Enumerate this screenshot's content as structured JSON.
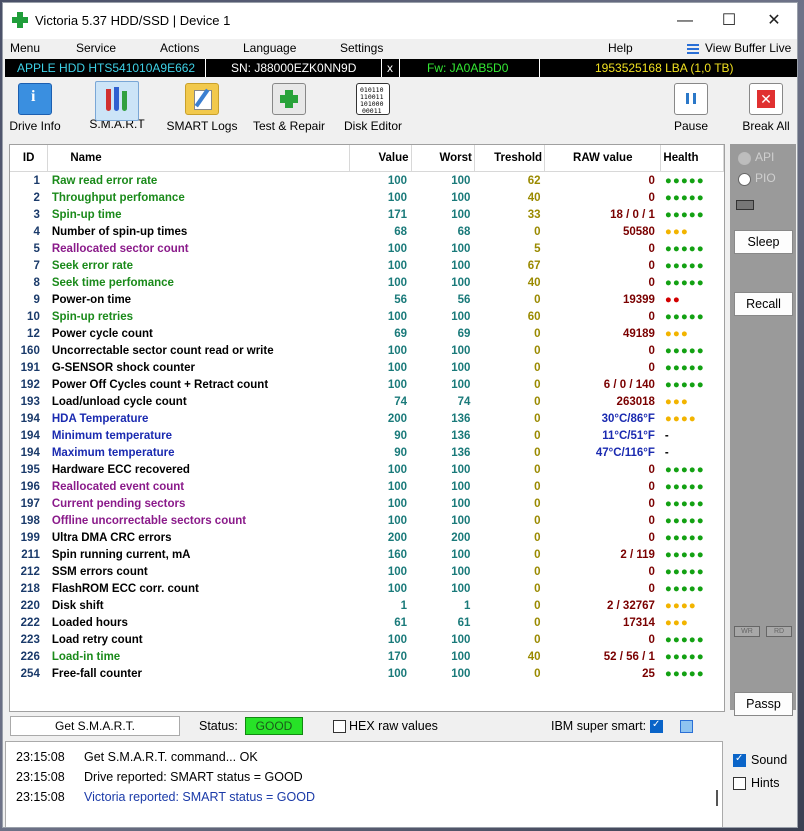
{
  "window": {
    "title": "Victoria 5.37 HDD/SSD | Device 1"
  },
  "menu": {
    "items": [
      "Menu",
      "Service",
      "Actions",
      "Language",
      "Settings",
      "Help"
    ],
    "view_buffer": "View Buffer Live"
  },
  "device": {
    "model": "APPLE HDD HTS541010A9E662",
    "sn": "SN: J88000EZK0NN9D",
    "close": "x",
    "fw": "Fw: JA0AB5D0",
    "lba": "1953525168 LBA (1,0 TB)"
  },
  "toolbar": {
    "buttons": [
      "Drive Info",
      "S.M.A.R.T",
      "SMART Logs",
      "Test & Repair",
      "Disk Editor",
      "Pause",
      "Break All"
    ]
  },
  "table": {
    "headers": [
      "ID",
      "Name",
      "Value",
      "Worst",
      "Treshold",
      "RAW value",
      "Health"
    ],
    "rows": [
      {
        "id": "1",
        "name": "Raw read error rate",
        "value": "100",
        "worst": "100",
        "thr": "62",
        "raw": "0",
        "health": "●●●●●",
        "hc": "green",
        "nc": "green"
      },
      {
        "id": "2",
        "name": "Throughput perfomance",
        "value": "100",
        "worst": "100",
        "thr": "40",
        "raw": "0",
        "health": "●●●●●",
        "hc": "green",
        "nc": "green"
      },
      {
        "id": "3",
        "name": "Spin-up time",
        "value": "171",
        "worst": "100",
        "thr": "33",
        "raw": "18 / 0 / 1",
        "health": "●●●●●",
        "hc": "green",
        "nc": "green"
      },
      {
        "id": "4",
        "name": "Number of spin-up times",
        "value": "68",
        "worst": "68",
        "thr": "0",
        "raw": "50580",
        "health": "●●●",
        "hc": "yellow",
        "nc": "black"
      },
      {
        "id": "5",
        "name": "Reallocated sector count",
        "value": "100",
        "worst": "100",
        "thr": "5",
        "raw": "0",
        "health": "●●●●●",
        "hc": "green",
        "nc": "purple"
      },
      {
        "id": "7",
        "name": "Seek error rate",
        "value": "100",
        "worst": "100",
        "thr": "67",
        "raw": "0",
        "health": "●●●●●",
        "hc": "green",
        "nc": "green"
      },
      {
        "id": "8",
        "name": "Seek time perfomance",
        "value": "100",
        "worst": "100",
        "thr": "40",
        "raw": "0",
        "health": "●●●●●",
        "hc": "green",
        "nc": "green"
      },
      {
        "id": "9",
        "name": "Power-on time",
        "value": "56",
        "worst": "56",
        "thr": "0",
        "raw": "19399",
        "health": "●●",
        "hc": "red",
        "nc": "black"
      },
      {
        "id": "10",
        "name": "Spin-up retries",
        "value": "100",
        "worst": "100",
        "thr": "60",
        "raw": "0",
        "health": "●●●●●",
        "hc": "green",
        "nc": "green"
      },
      {
        "id": "12",
        "name": "Power cycle count",
        "value": "69",
        "worst": "69",
        "thr": "0",
        "raw": "49189",
        "health": "●●●",
        "hc": "yellow",
        "nc": "black"
      },
      {
        "id": "160",
        "name": "Uncorrectable sector count read or write",
        "value": "100",
        "worst": "100",
        "thr": "0",
        "raw": "0",
        "health": "●●●●●",
        "hc": "green",
        "nc": "black"
      },
      {
        "id": "191",
        "name": "G-SENSOR shock counter",
        "value": "100",
        "worst": "100",
        "thr": "0",
        "raw": "0",
        "health": "●●●●●",
        "hc": "green",
        "nc": "black"
      },
      {
        "id": "192",
        "name": "Power Off Cycles count + Retract count",
        "value": "100",
        "worst": "100",
        "thr": "0",
        "raw": "6 / 0 / 140",
        "health": "●●●●●",
        "hc": "green",
        "nc": "black"
      },
      {
        "id": "193",
        "name": "Load/unload cycle count",
        "value": "74",
        "worst": "74",
        "thr": "0",
        "raw": "263018",
        "health": "●●●",
        "hc": "yellow",
        "nc": "black"
      },
      {
        "id": "194",
        "name": "HDA Temperature",
        "value": "200",
        "worst": "136",
        "thr": "0",
        "raw": "30°C/86°F",
        "health": "●●●●",
        "hc": "yellow",
        "nc": "blue",
        "rc": "blue"
      },
      {
        "id": "194",
        "name": "Minimum temperature",
        "value": "90",
        "worst": "136",
        "thr": "0",
        "raw": "11°C/51°F",
        "health": "-",
        "hc": "dash",
        "nc": "blue",
        "rc": "blue"
      },
      {
        "id": "194",
        "name": "Maximum temperature",
        "value": "90",
        "worst": "136",
        "thr": "0",
        "raw": "47°C/116°F",
        "health": "-",
        "hc": "dash",
        "nc": "blue",
        "rc": "blue"
      },
      {
        "id": "195",
        "name": "Hardware ECC recovered",
        "value": "100",
        "worst": "100",
        "thr": "0",
        "raw": "0",
        "health": "●●●●●",
        "hc": "green",
        "nc": "black"
      },
      {
        "id": "196",
        "name": "Reallocated event count",
        "value": "100",
        "worst": "100",
        "thr": "0",
        "raw": "0",
        "health": "●●●●●",
        "hc": "green",
        "nc": "purple"
      },
      {
        "id": "197",
        "name": "Current pending sectors",
        "value": "100",
        "worst": "100",
        "thr": "0",
        "raw": "0",
        "health": "●●●●●",
        "hc": "green",
        "nc": "purple"
      },
      {
        "id": "198",
        "name": "Offline uncorrectable sectors count",
        "value": "100",
        "worst": "100",
        "thr": "0",
        "raw": "0",
        "health": "●●●●●",
        "hc": "green",
        "nc": "purple"
      },
      {
        "id": "199",
        "name": "Ultra DMA CRC errors",
        "value": "200",
        "worst": "200",
        "thr": "0",
        "raw": "0",
        "health": "●●●●●",
        "hc": "green",
        "nc": "black"
      },
      {
        "id": "211",
        "name": "Spin running current, mA",
        "value": "160",
        "worst": "100",
        "thr": "0",
        "raw": "2 / 119",
        "health": "●●●●●",
        "hc": "green",
        "nc": "black"
      },
      {
        "id": "212",
        "name": "SSM errors count",
        "value": "100",
        "worst": "100",
        "thr": "0",
        "raw": "0",
        "health": "●●●●●",
        "hc": "green",
        "nc": "black"
      },
      {
        "id": "218",
        "name": "FlashROM ECC corr. count",
        "value": "100",
        "worst": "100",
        "thr": "0",
        "raw": "0",
        "health": "●●●●●",
        "hc": "green",
        "nc": "black"
      },
      {
        "id": "220",
        "name": "Disk shift",
        "value": "1",
        "worst": "1",
        "thr": "0",
        "raw": "2 / 32767",
        "health": "●●●●",
        "hc": "yellow",
        "nc": "black"
      },
      {
        "id": "222",
        "name": "Loaded hours",
        "value": "61",
        "worst": "61",
        "thr": "0",
        "raw": "17314",
        "health": "●●●",
        "hc": "yellow",
        "nc": "black"
      },
      {
        "id": "223",
        "name": "Load retry count",
        "value": "100",
        "worst": "100",
        "thr": "0",
        "raw": "0",
        "health": "●●●●●",
        "hc": "green",
        "nc": "black"
      },
      {
        "id": "226",
        "name": "Load-in time",
        "value": "170",
        "worst": "100",
        "thr": "40",
        "raw": "52 / 56 / 1",
        "health": "●●●●●",
        "hc": "green",
        "nc": "green"
      },
      {
        "id": "254",
        "name": "Free-fall counter",
        "value": "100",
        "worst": "100",
        "thr": "0",
        "raw": "25",
        "health": "●●●●●",
        "hc": "green",
        "nc": "black"
      }
    ]
  },
  "rpanel": {
    "api": "API",
    "pio": "PIO",
    "sleep": "Sleep",
    "recall": "Recall",
    "wr": "WR",
    "rd": "RD",
    "passp": "Passp"
  },
  "status": {
    "get_smart": "Get S.M.A.R.T.",
    "status_label": "Status:",
    "status_value": "GOOD",
    "hex_label": "HEX raw values",
    "ibm_label": "IBM super smart:"
  },
  "log": {
    "lines": [
      {
        "t": "23:15:08",
        "msg": "Get S.M.A.R.T. command... OK",
        "c": "black"
      },
      {
        "t": "23:15:08",
        "msg": "Drive reported: SMART status = GOOD",
        "c": "black"
      },
      {
        "t": "23:15:08",
        "msg": "Victoria reported: SMART status = GOOD",
        "c": "blue"
      }
    ]
  },
  "options": {
    "sound": "Sound",
    "hints": "Hints"
  }
}
